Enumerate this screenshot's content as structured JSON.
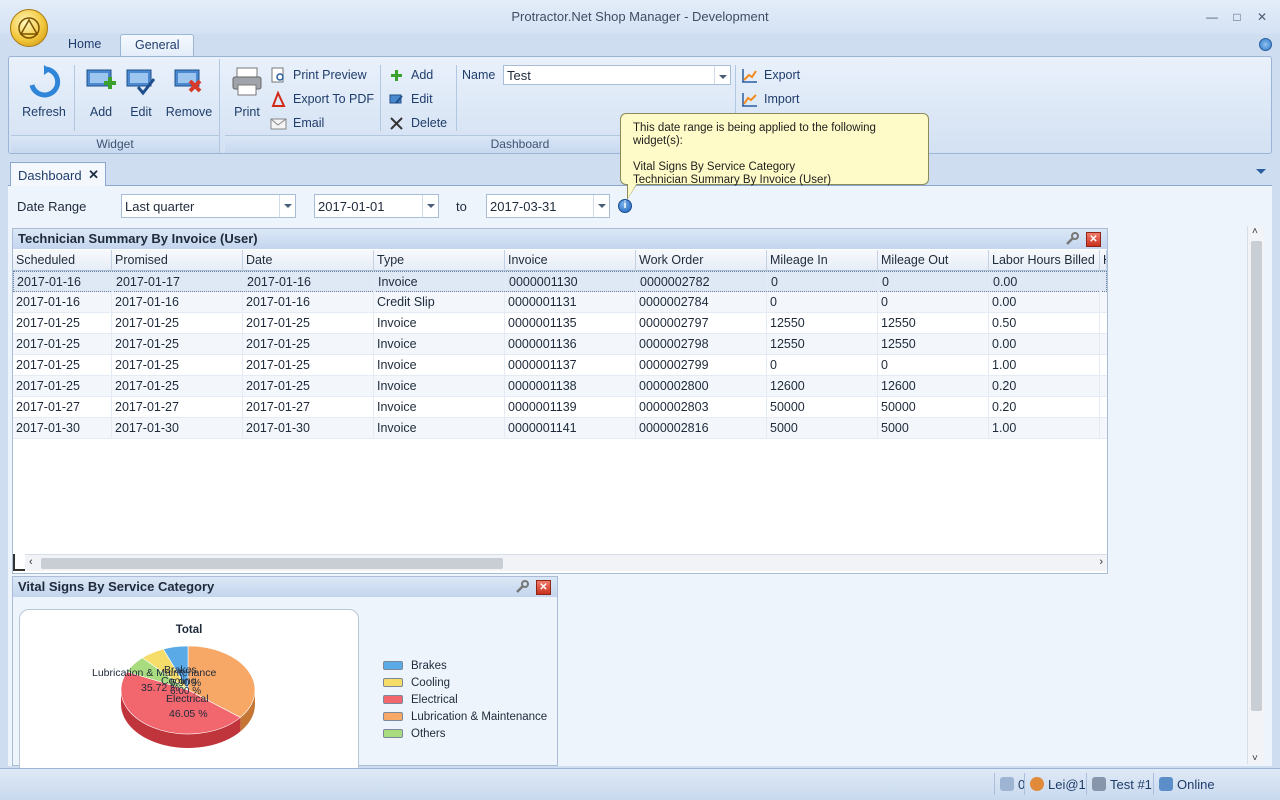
{
  "window": {
    "title": "Protractor.Net Shop Manager - Development"
  },
  "ribbon": {
    "tabs": [
      "Home",
      "General"
    ],
    "widget_group": {
      "caption": "Widget",
      "refresh": "Refresh",
      "add": "Add",
      "edit": "Edit",
      "remove": "Remove"
    },
    "dashboard_group": {
      "caption": "Dashboard",
      "print": "Print",
      "print_preview": "Print Preview",
      "export_pdf": "Export To PDF",
      "email": "Email",
      "add": "Add",
      "edit": "Edit",
      "delete": "Delete",
      "name_label": "Name",
      "name_value": "Test",
      "export": "Export",
      "import": "Import"
    }
  },
  "document_tab": {
    "label": "Dashboard"
  },
  "filters": {
    "date_range_label": "Date Range",
    "date_range_value": "Last quarter",
    "start_date": "2017-01-01",
    "to_label": "to",
    "end_date": "2017-03-31"
  },
  "tooltip": {
    "line1": "This date range is being applied to the following widget(s):",
    "line2": "Vital Signs By Service Category",
    "line3": "Technician Summary By Invoice (User)"
  },
  "tech_widget": {
    "title": "Technician Summary By Invoice (User)",
    "columns": [
      "Scheduled",
      "Promised",
      "Date",
      "Type",
      "Invoice",
      "Work Order",
      "Mileage In",
      "Mileage Out",
      "Labor Hours Billed",
      "H"
    ],
    "rows": [
      [
        "2017-01-16",
        "2017-01-17",
        "2017-01-16",
        "Invoice",
        "0000001130",
        "0000002782",
        "0",
        "0",
        "0.00"
      ],
      [
        "2017-01-16",
        "2017-01-16",
        "2017-01-16",
        "Credit Slip",
        "0000001131",
        "0000002784",
        "0",
        "0",
        "0.00"
      ],
      [
        "2017-01-25",
        "2017-01-25",
        "2017-01-25",
        "Invoice",
        "0000001135",
        "0000002797",
        "12550",
        "12550",
        "0.50"
      ],
      [
        "2017-01-25",
        "2017-01-25",
        "2017-01-25",
        "Invoice",
        "0000001136",
        "0000002798",
        "12550",
        "12550",
        "0.00"
      ],
      [
        "2017-01-25",
        "2017-01-25",
        "2017-01-25",
        "Invoice",
        "0000001137",
        "0000002799",
        "0",
        "0",
        "1.00"
      ],
      [
        "2017-01-25",
        "2017-01-25",
        "2017-01-25",
        "Invoice",
        "0000001138",
        "0000002800",
        "12600",
        "12600",
        "0.20"
      ],
      [
        "2017-01-27",
        "2017-01-27",
        "2017-01-27",
        "Invoice",
        "0000001139",
        "0000002803",
        "50000",
        "50000",
        "0.20"
      ],
      [
        "2017-01-30",
        "2017-01-30",
        "2017-01-30",
        "Invoice",
        "0000001141",
        "0000002816",
        "5000",
        "5000",
        "1.00"
      ]
    ]
  },
  "vital_widget": {
    "title": "Vital Signs By Service Category",
    "chart_title": "Total",
    "legend": [
      {
        "name": "Brakes",
        "color": "#5aaae8"
      },
      {
        "name": "Cooling",
        "color": "#f6dd6a"
      },
      {
        "name": "Electrical",
        "color": "#f2666e"
      },
      {
        "name": "Lubrication & Maintenance",
        "color": "#f7a867"
      },
      {
        "name": "Others",
        "color": "#a9dc7f"
      }
    ],
    "slice_labels": {
      "brakes": "Brakes",
      "cooling": "Cooling",
      "lubrication": "Lubrication & Maintenance",
      "lubrication_pct": "35.72 %",
      "electrical": "Electrical",
      "electrical_pct": "46.05 %",
      "small_a": "6.00 %",
      "small_b": "5.90 %"
    }
  },
  "chart_data": {
    "type": "pie",
    "title": "Total",
    "categories": [
      "Brakes",
      "Cooling",
      "Electrical",
      "Lubrication & Maintenance",
      "Others"
    ],
    "values": [
      6.0,
      5.9,
      46.05,
      35.72,
      6.33
    ]
  },
  "statusbar": {
    "count": "0",
    "user": "Lei@1",
    "test": "Test #1",
    "online": "Online"
  }
}
